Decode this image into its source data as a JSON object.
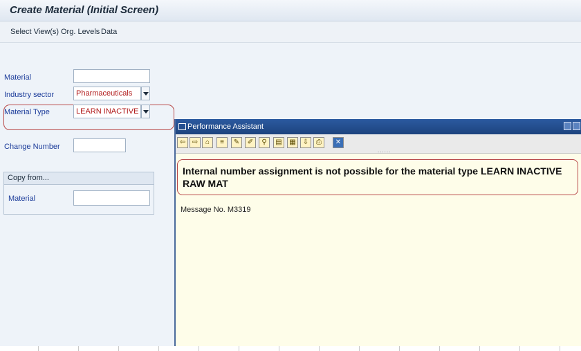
{
  "title": "Create Material (Initial Screen)",
  "menu": [
    "Select View(s)",
    "Org. Levels",
    "Data"
  ],
  "form": {
    "material_label": "Material",
    "material_value": "",
    "industry_label": "Industry sector",
    "industry_value": "Pharmaceuticals",
    "type_label": "Material Type",
    "type_value": "LEARN INACTIVE RA…",
    "change_label": "Change Number",
    "change_value": ""
  },
  "copy_from": {
    "header": "Copy from...",
    "material_label": "Material",
    "material_value": ""
  },
  "assistant": {
    "title": "Performance Assistant",
    "toolbar_dots": "......",
    "message": "Internal number assignment is not possible for the material type LEARN INACTIVE RAW MAT",
    "message_no": "Message No. M3319"
  },
  "colors": {
    "label": "#1c3c9a",
    "field_value": "#b01818",
    "highlight": "#b84848",
    "assistant_bg": "#fefde9"
  },
  "icons": [
    "back-icon",
    "forward-icon",
    "home-icon",
    "structure-icon",
    "edit-icon",
    "pen-icon",
    "link-icon",
    "document-icon",
    "display-icon",
    "download-icon",
    "print-icon",
    "close-icon"
  ]
}
